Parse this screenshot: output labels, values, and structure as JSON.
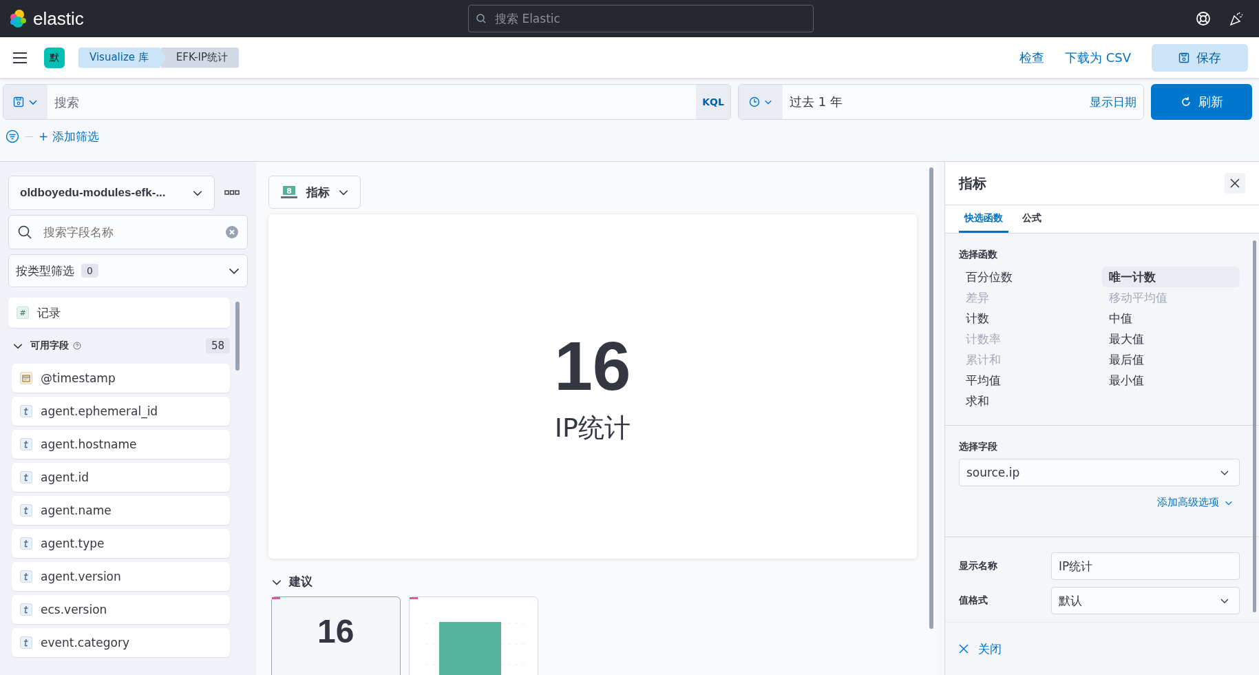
{
  "topbar": {
    "brand": "elastic",
    "search": {
      "placeholder": "搜索 Elastic"
    }
  },
  "header": {
    "space_badge": "默",
    "breadcrumbs": [
      {
        "label": "Visualize 库",
        "selected": false
      },
      {
        "label": "EFK-IP统计",
        "selected": true
      }
    ],
    "actions": [
      "检查",
      "下载为 CSV"
    ],
    "save": "保存"
  },
  "query": {
    "placeholder": "搜索",
    "language": "KQL",
    "time": "过去 1 年",
    "show_dates": "显示日期",
    "refresh": "刷新",
    "add_filter": "+ 添加筛选"
  },
  "fields_panel": {
    "index": "oldboyedu-modules-efk-...",
    "search": {
      "placeholder": "搜索字段名称"
    },
    "type_filter": "按类型筛选",
    "type_filter_count": "0",
    "records": {
      "label": "记录",
      "kind": "number",
      "icon_text": "#"
    },
    "available": {
      "label": "可用字段",
      "count": "58",
      "expanded": true
    },
    "fields": [
      {
        "name": "@timestamp",
        "kind": "date"
      },
      {
        "name": "agent.ephemeral_id",
        "kind": "string"
      },
      {
        "name": "agent.hostname",
        "kind": "string"
      },
      {
        "name": "agent.id",
        "kind": "string"
      },
      {
        "name": "agent.name",
        "kind": "string"
      },
      {
        "name": "agent.type",
        "kind": "string"
      },
      {
        "name": "agent.version",
        "kind": "string"
      },
      {
        "name": "ecs.version",
        "kind": "string"
      },
      {
        "name": "event.category",
        "kind": "string"
      }
    ]
  },
  "workspace": {
    "chart_type": {
      "label": "指标",
      "icon_digit": "8"
    },
    "metric": {
      "value": "16",
      "label": "IP统计"
    },
    "suggestions": {
      "title": "建议",
      "expanded": true,
      "items": [
        {
          "kind": "metric",
          "value": "16",
          "selected": true
        },
        {
          "kind": "bar",
          "selected": false
        }
      ]
    }
  },
  "editor": {
    "title": "指标",
    "tabs": [
      {
        "label": "快选函数",
        "selected": true
      },
      {
        "label": "公式",
        "selected": false
      }
    ],
    "functions_title": "选择函数",
    "functions": [
      {
        "label": "百分位数",
        "selected": false,
        "disabled": false
      },
      {
        "label": "差异",
        "selected": false,
        "disabled": true
      },
      {
        "label": "计数",
        "selected": false,
        "disabled": false
      },
      {
        "label": "计数率",
        "selected": false,
        "disabled": true
      },
      {
        "label": "累计和",
        "selected": false,
        "disabled": true
      },
      {
        "label": "平均值",
        "selected": false,
        "disabled": false
      },
      {
        "label": "求和",
        "selected": false,
        "disabled": false
      },
      {
        "label": "唯一计数",
        "selected": true,
        "disabled": false
      },
      {
        "label": "移动平均值",
        "selected": false,
        "disabled": true
      },
      {
        "label": "中值",
        "selected": false,
        "disabled": false
      },
      {
        "label": "最大值",
        "selected": false,
        "disabled": false
      },
      {
        "label": "最后值",
        "selected": false,
        "disabled": false
      },
      {
        "label": "最小值",
        "selected": false,
        "disabled": false
      }
    ],
    "field_title": "选择字段",
    "field_value": "source.ip",
    "advanced": "添加高级选项",
    "display_name_label": "显示名称",
    "display_name": "IP统计",
    "format_label": "值格式",
    "format": "默认",
    "close": "关闭"
  }
}
